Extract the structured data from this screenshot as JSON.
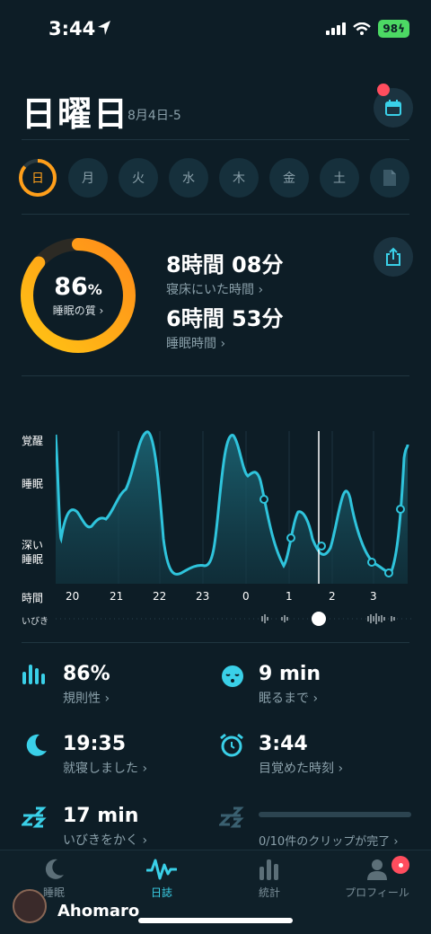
{
  "status_bar": {
    "time": "3:44",
    "battery": "98"
  },
  "header": {
    "day_title": "日曜日",
    "date_range": "8月4日-5"
  },
  "days": [
    "日",
    "月",
    "火",
    "水",
    "木",
    "金",
    "土"
  ],
  "summary": {
    "quality_value": "86",
    "quality_unit": "%",
    "quality_label": "睡眠の質 ›",
    "quality_fraction": 0.86,
    "in_bed_value": "8時間 08分",
    "in_bed_label": "寝床にいた時間 ›",
    "asleep_value": "6時間 53分",
    "asleep_label": "睡眠時間 ›"
  },
  "chart": {
    "y_labels": {
      "awake": "覚醒",
      "sleep": "睡眠",
      "deep_1": "深い",
      "deep_2": "睡眠"
    },
    "x_title": "時間",
    "snore_label": "いびき",
    "x_ticks": [
      "20",
      "21",
      "22",
      "23",
      "0",
      "1",
      "2",
      "3"
    ]
  },
  "stats": {
    "regularity_value": "86%",
    "regularity_label": "規則性 ›",
    "fall_asleep_value": "9 min",
    "fall_asleep_label": "眠るまで ›",
    "bedtime_value": "19:35",
    "bedtime_label": "就寝しました ›",
    "wake_value": "3:44",
    "wake_label": "目覚めた時刻 ›",
    "snore_value": "17 min",
    "snore_label": "いびきをかく ›",
    "clips_label": "0/10件のクリップが完了 ›"
  },
  "tabs": {
    "sleep": "睡眠",
    "journal": "日誌",
    "stats": "統計",
    "profile": "プロフィール"
  },
  "watermark": "Ahomaro",
  "colors": {
    "accent": "#3ad0e8",
    "orange": "#ff9f1a",
    "badge_red": "#ff4d5e"
  }
}
